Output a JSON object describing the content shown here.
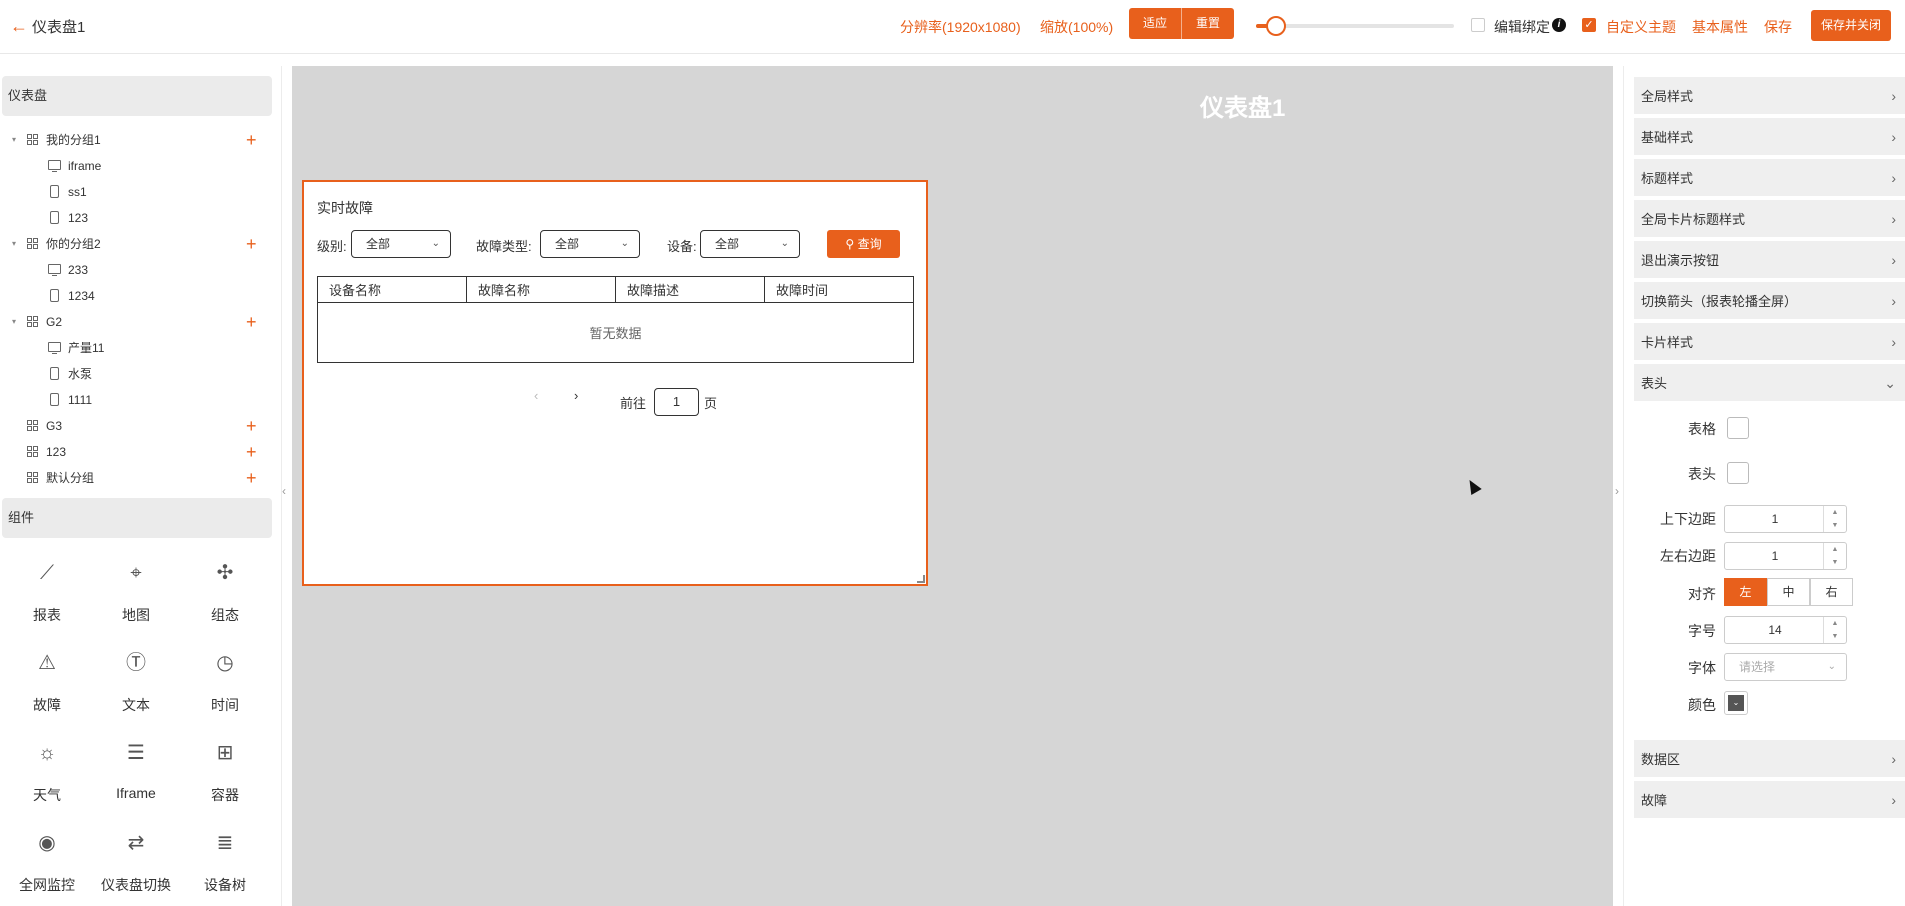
{
  "header": {
    "title": "仪表盘1",
    "resolution": "分辨率(1920x1080)",
    "zoom": "缩放(100%)",
    "fit_label": "适应",
    "reset_label": "重置",
    "zoom_slider_value": 0.1,
    "edit_bind_label": "编辑绑定",
    "edit_bind_checked": false,
    "custom_theme_label": "自定义主题",
    "custom_theme_checked": true,
    "basic_props_label": "基本属性",
    "save_label": "保存",
    "save_close_label": "保存并关闭"
  },
  "left": {
    "dashboard_header": "仪表盘",
    "tree": [
      {
        "label": "我的分组1",
        "children": [
          {
            "type": "monitor",
            "label": "iframe"
          },
          {
            "type": "phone",
            "label": "ss1"
          },
          {
            "type": "phone",
            "label": "123"
          }
        ]
      },
      {
        "label": "你的分组2",
        "children": [
          {
            "type": "monitor",
            "label": "233"
          },
          {
            "type": "phone",
            "label": "1234"
          }
        ]
      },
      {
        "label": "G2",
        "children": [
          {
            "type": "monitor",
            "label": "产量11"
          },
          {
            "type": "phone",
            "label": "水泵"
          },
          {
            "type": "phone",
            "label": "1111"
          }
        ]
      },
      {
        "label": "G3",
        "children": []
      },
      {
        "label": "123",
        "children": []
      },
      {
        "label": "默认分组",
        "children": []
      }
    ],
    "components_header": "组件",
    "components": [
      {
        "icon": "chart-line-icon",
        "label": "报表"
      },
      {
        "icon": "map-icon",
        "label": "地图"
      },
      {
        "icon": "puzzle-icon",
        "label": "组态"
      },
      {
        "icon": "warning-icon",
        "label": "故障"
      },
      {
        "icon": "text-icon",
        "label": "文本"
      },
      {
        "icon": "clock-icon",
        "label": "时间"
      },
      {
        "icon": "weather-icon",
        "label": "天气"
      },
      {
        "icon": "iframe-icon",
        "label": "Iframe"
      },
      {
        "icon": "container-icon",
        "label": "容器"
      },
      {
        "icon": "camera-icon",
        "label": "全网监控"
      },
      {
        "icon": "switch-icon",
        "label": "仪表盘切换"
      },
      {
        "icon": "tree-icon",
        "label": "设备树"
      }
    ]
  },
  "canvas": {
    "title": "仪表盘1",
    "card": {
      "title": "实时故障",
      "level_label": "级别:",
      "level_value": "全部",
      "fault_type_label": "故障类型:",
      "fault_type_value": "全部",
      "device_label": "设备:",
      "device_value": "全部",
      "query_label": "查询",
      "columns": [
        "设备名称",
        "故障名称",
        "故障描述",
        "故障时间"
      ],
      "empty_text": "暂无数据",
      "goto_label": "前往",
      "page": "1",
      "page_suffix": "页"
    }
  },
  "right": {
    "sections_top": [
      "全局样式",
      "基础样式",
      "标题样式",
      "全局卡片标题样式",
      "退出演示按钮",
      "切换箭头（报表轮播全屏）",
      "卡片样式",
      "表头"
    ],
    "table_label": "表格",
    "header_label": "表头",
    "tb_margin_label": "上下边距",
    "tb_margin_value": "1",
    "lr_margin_label": "左右边距",
    "lr_margin_value": "1",
    "align_label": "对齐",
    "align_options": [
      "左",
      "中",
      "右"
    ],
    "font_size_label": "字号",
    "font_size_value": "14",
    "font_label": "字体",
    "font_placeholder": "请选择",
    "color_label": "颜色",
    "color_value": "#555555",
    "sections_bottom": [
      "数据区",
      "故障"
    ]
  }
}
